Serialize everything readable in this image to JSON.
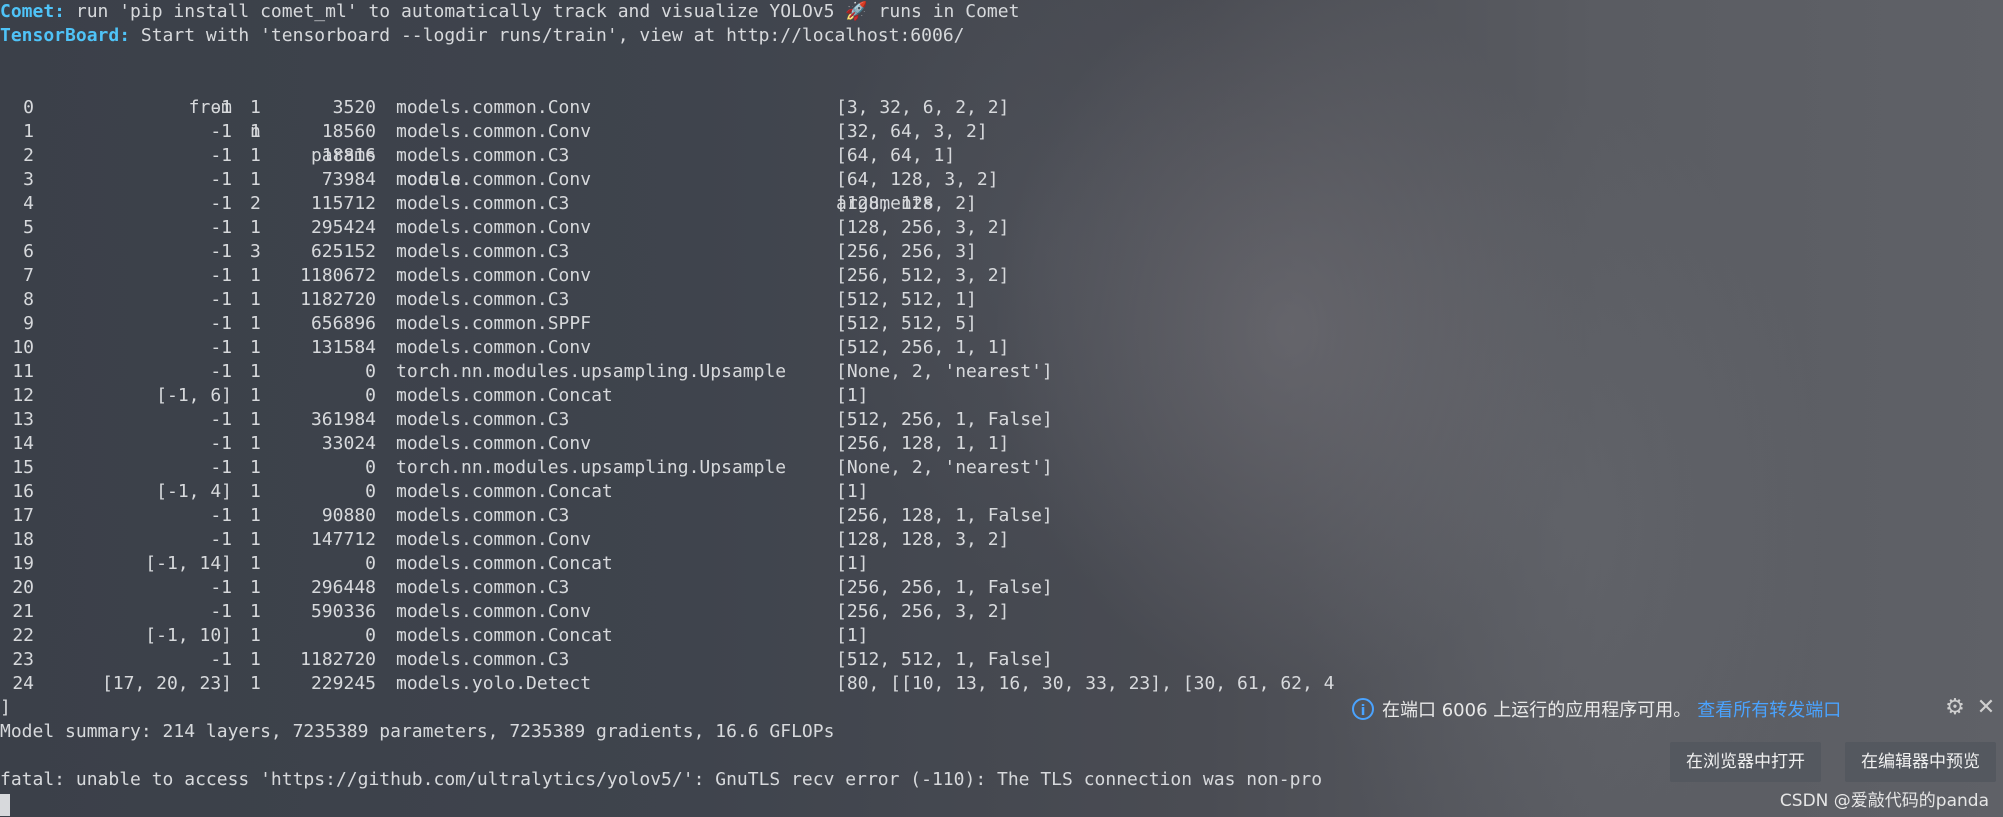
{
  "header_lines": [
    {
      "label": "Comet:",
      "text": " run 'pip install comet_ml' to automatically track and visualize YOLOv5 🚀 runs in Comet"
    },
    {
      "label": "TensorBoard:",
      "text": " Start with 'tensorboard --logdir runs/train', view at http://localhost:6006/"
    }
  ],
  "table": {
    "headers": {
      "from": "from",
      "n": "n",
      "params": "params",
      "module": "module",
      "arguments": "arguments"
    },
    "rows": [
      {
        "idx": "0",
        "from": "-1",
        "n": "1",
        "params": "3520",
        "module": "models.common.Conv",
        "args": "[3, 32, 6, 2, 2]"
      },
      {
        "idx": "1",
        "from": "-1",
        "n": "1",
        "params": "18560",
        "module": "models.common.Conv",
        "args": "[32, 64, 3, 2]"
      },
      {
        "idx": "2",
        "from": "-1",
        "n": "1",
        "params": "18816",
        "module": "models.common.C3",
        "args": "[64, 64, 1]"
      },
      {
        "idx": "3",
        "from": "-1",
        "n": "1",
        "params": "73984",
        "module": "models.common.Conv",
        "args": "[64, 128, 3, 2]"
      },
      {
        "idx": "4",
        "from": "-1",
        "n": "2",
        "params": "115712",
        "module": "models.common.C3",
        "args": "[128, 128, 2]"
      },
      {
        "idx": "5",
        "from": "-1",
        "n": "1",
        "params": "295424",
        "module": "models.common.Conv",
        "args": "[128, 256, 3, 2]"
      },
      {
        "idx": "6",
        "from": "-1",
        "n": "3",
        "params": "625152",
        "module": "models.common.C3",
        "args": "[256, 256, 3]"
      },
      {
        "idx": "7",
        "from": "-1",
        "n": "1",
        "params": "1180672",
        "module": "models.common.Conv",
        "args": "[256, 512, 3, 2]"
      },
      {
        "idx": "8",
        "from": "-1",
        "n": "1",
        "params": "1182720",
        "module": "models.common.C3",
        "args": "[512, 512, 1]"
      },
      {
        "idx": "9",
        "from": "-1",
        "n": "1",
        "params": "656896",
        "module": "models.common.SPPF",
        "args": "[512, 512, 5]"
      },
      {
        "idx": "10",
        "from": "-1",
        "n": "1",
        "params": "131584",
        "module": "models.common.Conv",
        "args": "[512, 256, 1, 1]"
      },
      {
        "idx": "11",
        "from": "-1",
        "n": "1",
        "params": "0",
        "module": "torch.nn.modules.upsampling.Upsample",
        "args": "[None, 2, 'nearest']"
      },
      {
        "idx": "12",
        "from": "[-1, 6]",
        "n": "1",
        "params": "0",
        "module": "models.common.Concat",
        "args": "[1]"
      },
      {
        "idx": "13",
        "from": "-1",
        "n": "1",
        "params": "361984",
        "module": "models.common.C3",
        "args": "[512, 256, 1, False]"
      },
      {
        "idx": "14",
        "from": "-1",
        "n": "1",
        "params": "33024",
        "module": "models.common.Conv",
        "args": "[256, 128, 1, 1]"
      },
      {
        "idx": "15",
        "from": "-1",
        "n": "1",
        "params": "0",
        "module": "torch.nn.modules.upsampling.Upsample",
        "args": "[None, 2, 'nearest']"
      },
      {
        "idx": "16",
        "from": "[-1, 4]",
        "n": "1",
        "params": "0",
        "module": "models.common.Concat",
        "args": "[1]"
      },
      {
        "idx": "17",
        "from": "-1",
        "n": "1",
        "params": "90880",
        "module": "models.common.C3",
        "args": "[256, 128, 1, False]"
      },
      {
        "idx": "18",
        "from": "-1",
        "n": "1",
        "params": "147712",
        "module": "models.common.Conv",
        "args": "[128, 128, 3, 2]"
      },
      {
        "idx": "19",
        "from": "[-1, 14]",
        "n": "1",
        "params": "0",
        "module": "models.common.Concat",
        "args": "[1]"
      },
      {
        "idx": "20",
        "from": "-1",
        "n": "1",
        "params": "296448",
        "module": "models.common.C3",
        "args": "[256, 256, 1, False]"
      },
      {
        "idx": "21",
        "from": "-1",
        "n": "1",
        "params": "590336",
        "module": "models.common.Conv",
        "args": "[256, 256, 3, 2]"
      },
      {
        "idx": "22",
        "from": "[-1, 10]",
        "n": "1",
        "params": "0",
        "module": "models.common.Concat",
        "args": "[1]"
      },
      {
        "idx": "23",
        "from": "-1",
        "n": "1",
        "params": "1182720",
        "module": "models.common.C3",
        "args": "[512, 512, 1, False]"
      },
      {
        "idx": "24",
        "from": "[17, 20, 23]",
        "n": "1",
        "params": "229245",
        "module": "models.yolo.Detect",
        "args": "[80, [[10, 13, 16, 30, 33, 23], [30, 61, 62, 4"
      }
    ]
  },
  "closing_bracket": "]",
  "summary_line": "Model summary: 214 layers, 7235389 parameters, 7235389 gradients, 16.6 GFLOPs",
  "fatal_line": "fatal: unable to access 'https://github.com/ultralytics/yolov5/': GnuTLS recv error (-110): The TLS connection was non-pro",
  "notification": {
    "icon": "info-icon",
    "message": "在端口 6006 上运行的应用程序可用。",
    "link": "查看所有转发端口",
    "open_browser_button": "在浏览器中打开",
    "preview_button": "在编辑器中预览"
  },
  "watermark": "CSDN @爱敲代码的panda",
  "colors": {
    "accent": "#4aa3ff",
    "comet": "#4fc3f7",
    "text": "#d7d9dc"
  }
}
